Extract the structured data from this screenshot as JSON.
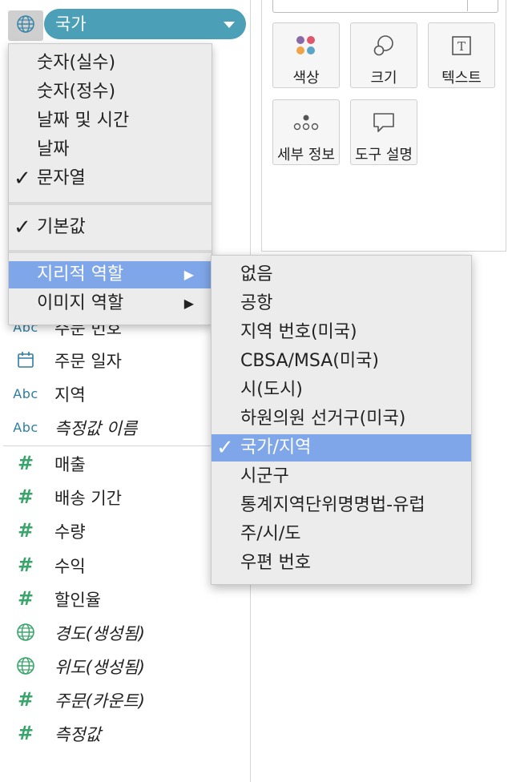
{
  "field_header": {
    "icon": "globe-icon",
    "pill_label": "국가",
    "pill_color": "#4b9fb6"
  },
  "fields": [
    {
      "type": "abc",
      "label": "주문 번호",
      "italic": false
    },
    {
      "type": "date",
      "label": "주문 일자",
      "italic": false
    },
    {
      "type": "abc",
      "label": "지역",
      "italic": false
    },
    {
      "type": "abc",
      "label": "측정값 이름",
      "italic": true
    },
    {
      "type": "measure",
      "label": "매출",
      "italic": false
    },
    {
      "type": "measure",
      "label": "배송 기간",
      "italic": false
    },
    {
      "type": "measure",
      "label": "수량",
      "italic": false
    },
    {
      "type": "measure",
      "label": "수익",
      "italic": false
    },
    {
      "type": "measure",
      "label": "할인율",
      "italic": false
    },
    {
      "type": "geo",
      "label": "경도(생성됨)",
      "italic": true
    },
    {
      "type": "geo",
      "label": "위도(생성됨)",
      "italic": true
    },
    {
      "type": "measure",
      "label": "주문(카운트)",
      "italic": true
    },
    {
      "type": "measure",
      "label": "측정값",
      "italic": true
    }
  ],
  "field_type_labels": {
    "abc": "Abc",
    "measure": "#"
  },
  "marks": {
    "buttons": [
      {
        "label": "색상",
        "icon": "color-dots-icon"
      },
      {
        "label": "크기",
        "icon": "size-circles-icon"
      },
      {
        "label": "텍스트",
        "icon": "text-box-icon"
      },
      {
        "label": "세부 정보",
        "icon": "detail-dots-icon"
      },
      {
        "label": "도구 설명",
        "icon": "tooltip-icon"
      }
    ],
    "text_icon_glyph": "T"
  },
  "context_menu": {
    "data_types": [
      {
        "label": "숫자(실수)",
        "checked": false
      },
      {
        "label": "숫자(정수)",
        "checked": false
      },
      {
        "label": "날짜 및 시간",
        "checked": false
      },
      {
        "label": "날짜",
        "checked": false
      },
      {
        "label": "문자열",
        "checked": true
      }
    ],
    "default_item": {
      "label": "기본값",
      "checked": true
    },
    "role_items": [
      {
        "label": "지리적 역할",
        "highlighted": true,
        "arrow": "▶"
      },
      {
        "label": "이미지 역할",
        "highlighted": false,
        "arrow": "▶"
      }
    ],
    "check_glyph": "✓"
  },
  "geo_submenu": {
    "items": [
      {
        "label": "없음",
        "checked": false
      },
      {
        "label": "공항",
        "checked": false
      },
      {
        "label": "지역 번호(미국)",
        "checked": false
      },
      {
        "label": "CBSA/MSA(미국)",
        "checked": false
      },
      {
        "label": "시(도시)",
        "checked": false
      },
      {
        "label": "하원의원 선거구(미국)",
        "checked": false
      },
      {
        "label": "국가/지역",
        "checked": true
      },
      {
        "label": "시군구",
        "checked": false
      },
      {
        "label": "통계지역단위명명법-유럽",
        "checked": false
      },
      {
        "label": "주/시/도",
        "checked": false
      },
      {
        "label": "우편 번호",
        "checked": false
      }
    ],
    "highlight_color": "#7fa6e8"
  }
}
